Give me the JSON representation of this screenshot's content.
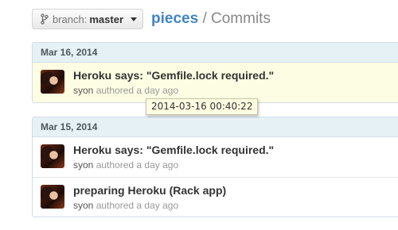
{
  "header": {
    "branch_prefix": "branch:",
    "branch_name": "master",
    "repo": "pieces",
    "separator": "/",
    "page": "Commits"
  },
  "groups": [
    {
      "date": "Mar 16, 2014",
      "commits": [
        {
          "message": "Heroku says: \"Gemfile.lock required.\"",
          "author": "syon",
          "authored": "authored",
          "time": "a day ago"
        }
      ]
    },
    {
      "date": "Mar 15, 2014",
      "commits": [
        {
          "message": "Heroku says: \"Gemfile.lock required.\"",
          "author": "syon",
          "authored": "authored",
          "time": "a day ago"
        },
        {
          "message": "preparing Heroku (Rack app)",
          "author": "syon",
          "authored": "authored",
          "time": "a day ago"
        }
      ]
    }
  ],
  "tooltip": "2014-03-16 00:40:22"
}
